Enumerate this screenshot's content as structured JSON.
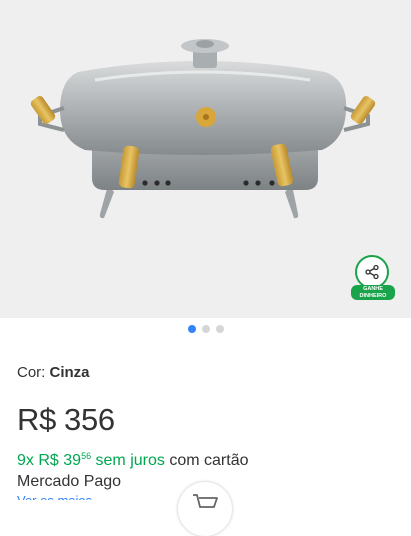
{
  "gallery": {
    "image_alt": "Churrasqueira de alumínio",
    "slides_total": 3,
    "active_slide": 1
  },
  "share": {
    "icon": "share-icon",
    "label_line1": "GANHE",
    "label_line2": "DINHEIRO"
  },
  "variation": {
    "label": "Cor:",
    "value": "Cinza"
  },
  "price": {
    "currency": "R$",
    "amount": "356"
  },
  "installments": {
    "count_text": "9x",
    "currency": "R$",
    "integer": "39",
    "cents": "56",
    "no_interest": "sem juros",
    "suffix": "com cartão",
    "method": "Mercado Pago"
  },
  "links": {
    "more_payment_options": "Ver os meios de pagamento"
  },
  "cart_button": {
    "icon": "cart-icon"
  },
  "colors": {
    "accent_blue": "#3483fa",
    "success_green": "#00a650",
    "share_green": "#19a34a",
    "gallery_bg": "#efefef"
  }
}
